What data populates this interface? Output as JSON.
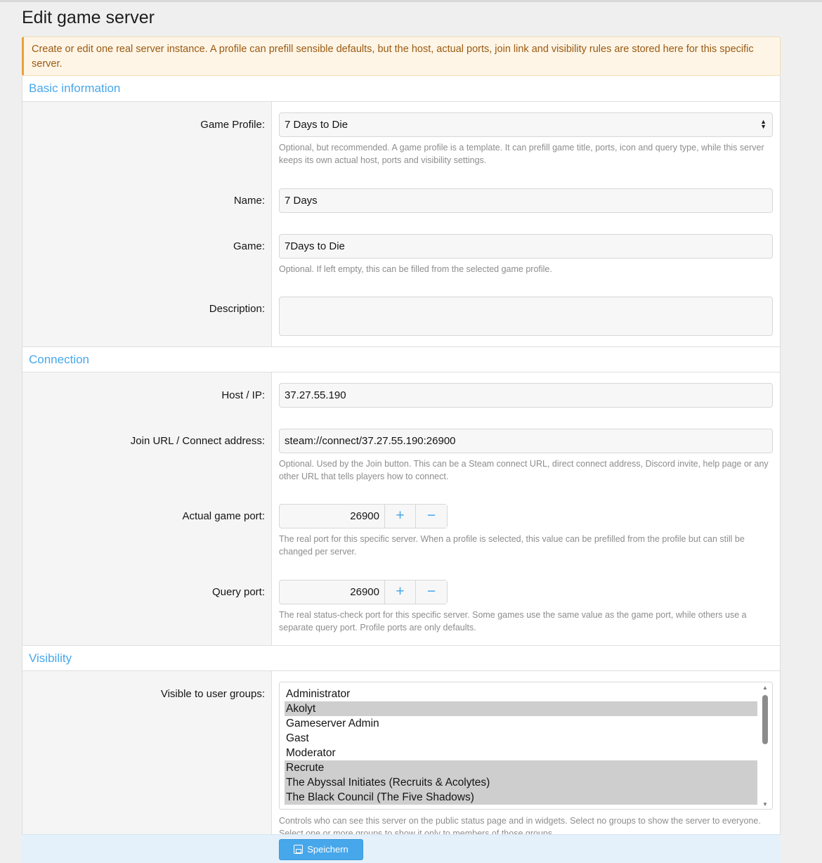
{
  "page": {
    "title": "Edit game server"
  },
  "notice": {
    "text": "Create or edit one real server instance. A profile can prefill sensible defaults, but the host, actual ports, join link and visibility rules are stored here for this specific server."
  },
  "sections": {
    "basic": "Basic information",
    "connection": "Connection",
    "visibility": "Visibility"
  },
  "basic": {
    "profile_label": "Game Profile:",
    "profile_value": "7 Days to Die",
    "profile_hint": "Optional, but recommended. A game profile is a template. It can prefill game title, ports, icon and query type, while this server keeps its own actual host, ports and visibility settings.",
    "name_label": "Name:",
    "name_value": "7 Days",
    "game_label": "Game:",
    "game_value": "7Days to Die",
    "game_hint": "Optional. If left empty, this can be filled from the selected game profile.",
    "description_label": "Description:",
    "description_value": ""
  },
  "connection": {
    "host_label": "Host / IP:",
    "host_value": "37.27.55.190",
    "join_label": "Join URL / Connect address:",
    "join_value": "steam://connect/37.27.55.190:26900",
    "join_hint": "Optional. Used by the Join button. This can be a Steam connect URL, direct connect address, Discord invite, help page or any other URL that tells players how to connect.",
    "game_port_label": "Actual game port:",
    "game_port_value": "26900",
    "game_port_hint": "The real port for this specific server. When a profile is selected, this value can be prefilled from the profile but can still be changed per server.",
    "query_port_label": "Query port:",
    "query_port_value": "26900",
    "query_port_hint": "The real status-check port for this specific server. Some games use the same value as the game port, while others use a separate query port. Profile ports are only defaults.",
    "plus": "+",
    "minus": "−"
  },
  "visibility": {
    "groups_label": "Visible to user groups:",
    "groups": [
      {
        "label": "Administrator",
        "selected": false
      },
      {
        "label": "Akolyt",
        "selected": true
      },
      {
        "label": "Gameserver Admin",
        "selected": false
      },
      {
        "label": "Gast",
        "selected": false
      },
      {
        "label": "Moderator",
        "selected": false
      },
      {
        "label": "Recrute",
        "selected": true
      },
      {
        "label": "The Abyssal Initiates (Recruits & Acolytes)",
        "selected": true
      },
      {
        "label": "The Black Council (The Five Shadows)",
        "selected": true
      }
    ],
    "groups_hint": "Controls who can see this server on the public status page and in widgets. Select no groups to show the server to everyone. Select one or more groups to show it only to members of those groups."
  },
  "footer": {
    "save_label": "Speichern"
  }
}
